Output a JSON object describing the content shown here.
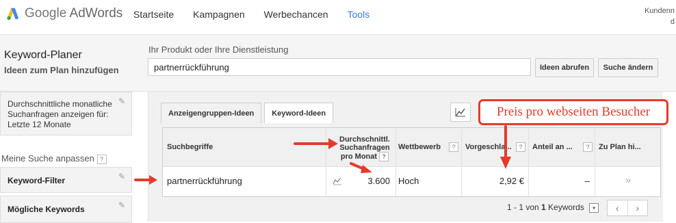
{
  "app": {
    "logo_text_google": "Google",
    "logo_text_product": "AdWords"
  },
  "nav": {
    "items": [
      {
        "label": "Startseite",
        "active": false
      },
      {
        "label": "Kampagnen",
        "active": false
      },
      {
        "label": "Werbechancen",
        "active": false
      },
      {
        "label": "Tools",
        "active": true
      }
    ],
    "customer_line1": "Kundenn",
    "customer_line2": "d"
  },
  "header": {
    "title": "Keyword-Planer",
    "subtitle": "Ideen zum Plan hinzufügen",
    "product_label": "Ihr Produkt oder Ihre Dienstleistung",
    "product_value": "partnerrückführung",
    "btn_ideas": "Ideen abrufen",
    "btn_change": "Suche ändern"
  },
  "sidebar": {
    "box1_text": "Durchschnittliche monatliche Suchanfragen anzeigen für: Letzte 12 Monate",
    "customize_label": "Meine Suche anpassen",
    "keyword_filter": "Keyword-Filter",
    "possible_keywords": "Mögliche Keywords"
  },
  "tabs": [
    {
      "label": "Anzeigengruppen-Ideen",
      "active": false
    },
    {
      "label": "Keyword-Ideen",
      "active": true
    }
  ],
  "table": {
    "headers": {
      "term": "Suchbegriffe",
      "avg_line1": "Durchschnittl.",
      "avg_line2": "Suchanfragen",
      "avg_line3": "pro Monat",
      "competition": "Wettbewerb",
      "bid": "Vorgeschla...",
      "share": "Anteil an ...",
      "add": "Zu Plan hi..."
    },
    "row": {
      "term": "partnerrückführung",
      "avg": "3.600",
      "competition": "Hoch",
      "bid": "2,92 €",
      "share": "–",
      "add": "»"
    }
  },
  "pager": {
    "prefix": "1 - 1 von ",
    "count": "1",
    "suffix": " Keywords"
  },
  "annotation": {
    "callout": "Preis pro webseiten Besucher",
    "color": "#e53a2a"
  },
  "icons": [
    "adwords-logo-icon",
    "pencil-icon",
    "help-icon",
    "chart-icon",
    "sparkline-icon",
    "add-arrow-icon",
    "prev-icon",
    "next-icon",
    "dropdown-icon",
    "red-arrow-icon"
  ]
}
